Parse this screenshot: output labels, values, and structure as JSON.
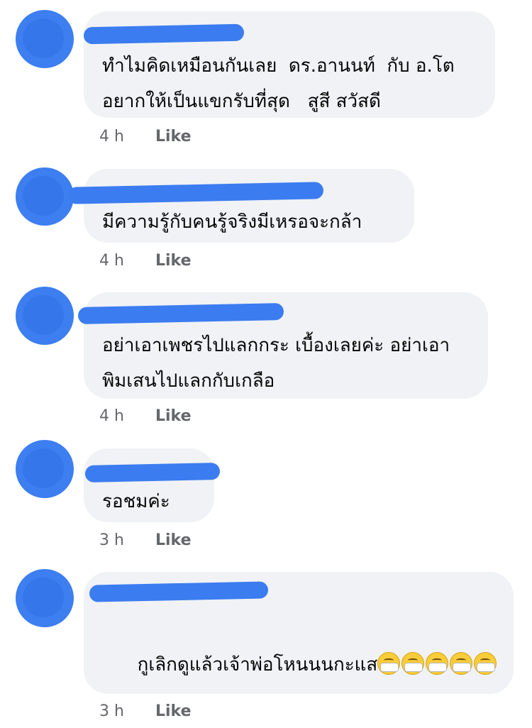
{
  "comments": [
    {
      "text": "ทำไมคิดเหมือนกันเลย  ดร.อานนท์  กับ อ.โต  อยากให้เป็นแขกรับที่สุด   สูสี สวัสดี",
      "time": "4 h",
      "like": "Like"
    },
    {
      "text": "มีความรู้กับคนรู้จริงมีเหรอจะกล้า",
      "time": "4 h",
      "like": "Like"
    },
    {
      "text": "อย่าเอาเพชรไปแลกกระ เบื้องเลยค่ะ อย่าเอาพิมเสนไปแลกกับเกลือ",
      "time": "4 h",
      "like": "Like"
    },
    {
      "text": "รอชมค่ะ",
      "time": "3 h",
      "like": "Like"
    },
    {
      "text": "กูเลิกดูแล้วเจ้าพ่อโหนนนกะแส",
      "emoji": "face-with-medical-mask-emoji",
      "emoji_count": 5,
      "time": "3 h",
      "like": "Like"
    }
  ],
  "colors": {
    "bubble": "#f0f2f5",
    "redaction": "#3b7cf0",
    "meta": "#65676b"
  }
}
